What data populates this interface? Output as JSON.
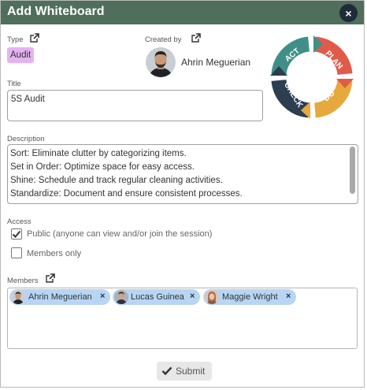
{
  "dialog": {
    "title": "Add Whiteboard",
    "close_symbol": "×"
  },
  "type": {
    "label": "Type",
    "value": "Audit",
    "value_color": "#e6b3f2"
  },
  "created_by": {
    "label": "Created by",
    "name": "Ahrin Meguerian"
  },
  "pdca_logo": {
    "segments": [
      "PLAN",
      "DO",
      "CHECK",
      "ACT"
    ],
    "colors": {
      "plan": "#e05a4a",
      "do": "#e7a83e",
      "check": "#2c3e50",
      "act": "#3f8f88"
    }
  },
  "title_field": {
    "label": "Title",
    "value": "5S Audit"
  },
  "description": {
    "label": "Description",
    "lines": [
      "Sort: Eliminate clutter by categorizing items.",
      "Set in Order: Optimize space for easy access.",
      "Shine: Schedule and track regular cleaning activities.",
      "Standardize: Document and ensure consistent processes."
    ]
  },
  "access": {
    "label": "Access",
    "public": {
      "label": "Public (anyone can view and/or join the session)",
      "checked": true
    },
    "members_only": {
      "label": "Members only",
      "checked": false
    }
  },
  "members": {
    "label": "Members",
    "list": [
      {
        "name": "Ahrin Meguerian",
        "remove": "×"
      },
      {
        "name": "Lucas Guinea",
        "remove": "×"
      },
      {
        "name": "Maggie Wright",
        "remove": "×"
      }
    ]
  },
  "submit": {
    "label": "Submit"
  },
  "colors": {
    "titlebar": "#4f6e5b",
    "close_button": "#1e2c3a",
    "member_chip": "#b7d6f5"
  },
  "icons": {
    "close": "close-icon",
    "external_link": "external-link-icon",
    "check": "checkmark-icon"
  }
}
